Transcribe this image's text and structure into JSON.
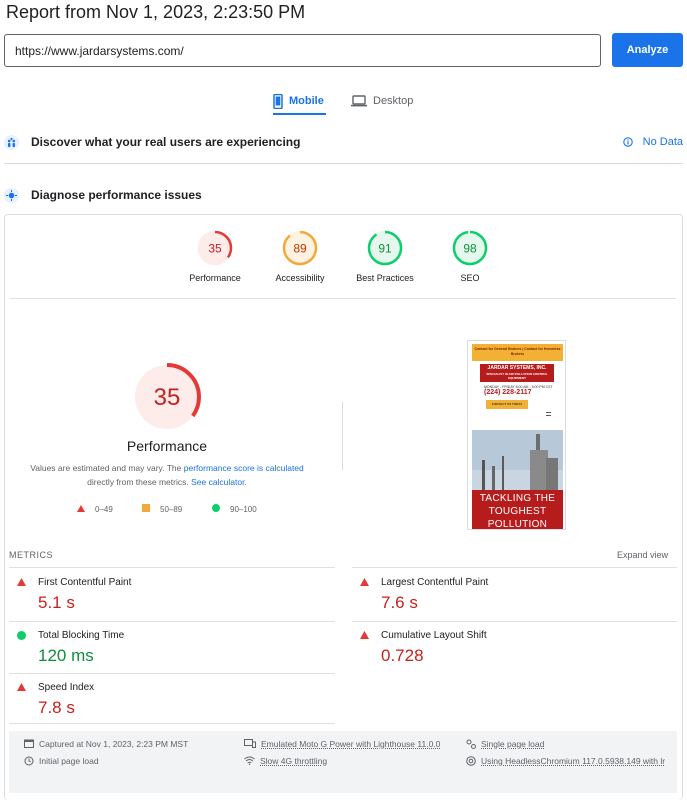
{
  "header": {
    "title": "Report from Nov 1, 2023, 2:23:50 PM",
    "url_value": "https://www.jardarsystems.com/",
    "analyze_label": "Analyze"
  },
  "tabs": [
    {
      "label": "Mobile",
      "active": true,
      "icon": "phone-icon"
    },
    {
      "label": "Desktop",
      "active": false,
      "icon": "laptop-icon"
    }
  ],
  "sections": {
    "real_users": {
      "title": "Discover what your real users are experiencing",
      "status": "No Data"
    },
    "diagnose": {
      "title": "Diagnose performance issues"
    }
  },
  "scores": [
    {
      "label": "Performance",
      "value": 35,
      "color": "#e53935",
      "track": "#fdecea"
    },
    {
      "label": "Accessibility",
      "value": 89,
      "color": "#f2a93b",
      "track": "#fef3e0"
    },
    {
      "label": "Best Practices",
      "value": 91,
      "color": "#0cce6b",
      "track": "#e6f8ee"
    },
    {
      "label": "SEO",
      "value": 98,
      "color": "#0cce6b",
      "track": "#e6f8ee"
    }
  ],
  "main_score": {
    "value": "35",
    "label": "Performance",
    "note_prefix": "Values are estimated and may vary. The",
    "note_link1": "performance score is calculated",
    "note_mid": "directly from these metrics.",
    "note_link2": "See calculator."
  },
  "legend": [
    {
      "range": "0–49",
      "color": "#e53935",
      "shape": "triangle"
    },
    {
      "range": "50–89",
      "color": "#f2a93b",
      "shape": "square"
    },
    {
      "range": "90–100",
      "color": "#0cce6b",
      "shape": "circle"
    }
  ],
  "screenshot": {
    "banner": "Contact for General Brokers | Contact for Homeless Brokers",
    "logo": "JARDAR SYSTEMS, INC.",
    "logo_sub": "SPECIALIST IN AIR POLLUTION CONTROL EQUIPMENT",
    "info": "MONDAY - FRIDAY 8:00 AM - 5:00 PM CST",
    "phone": "(224) 228-2117",
    "cta": "CONTACT US TODAY",
    "hero_text": "TACKLING THE TOUGHEST POLLUTION"
  },
  "metrics": {
    "heading": "METRICS",
    "expand": "Expand view",
    "items": [
      {
        "name": "First Contentful Paint",
        "value": "5.1 s",
        "status": "poor"
      },
      {
        "name": "Largest Contentful Paint",
        "value": "7.6 s",
        "status": "poor"
      },
      {
        "name": "Total Blocking Time",
        "value": "120 ms",
        "status": "good"
      },
      {
        "name": "Cumulative Layout Shift",
        "value": "0.728",
        "status": "poor"
      },
      {
        "name": "Speed Index",
        "value": "7.8 s",
        "status": "poor"
      }
    ]
  },
  "environment": {
    "captured": "Captured at Nov 1, 2023, 2:23 PM MST",
    "initial": "Initial page load",
    "device": "Emulated Moto G Power with Lighthouse 11.0.0",
    "throttling": "Slow 4G throttling",
    "single": "Single page load",
    "browser": "Using HeadlessChromium 117.0.5938.149 with lr"
  },
  "colors": {
    "accent": "#1a73e8",
    "poor": "#c5221f",
    "good": "#0d8f3b",
    "average": "#f2a93b"
  }
}
